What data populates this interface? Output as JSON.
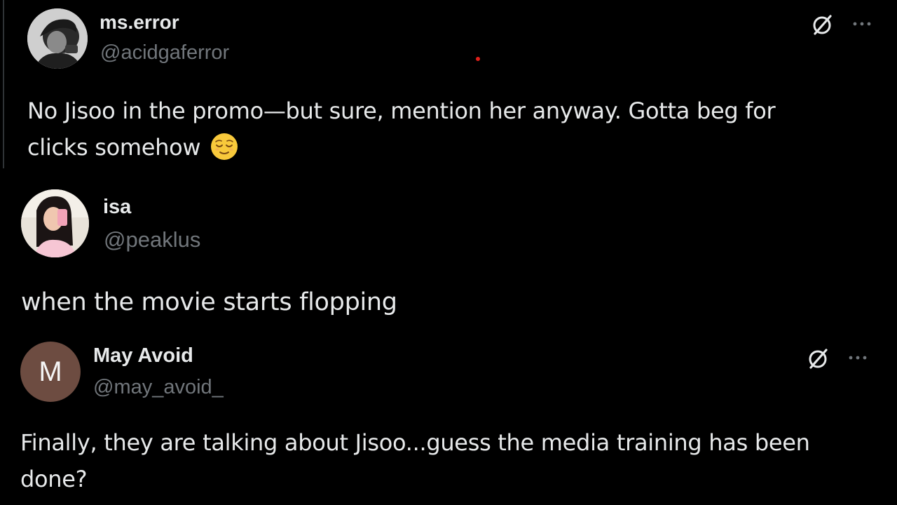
{
  "accent_colors": {
    "background": "#000000",
    "text_primary": "#e7e9ea",
    "text_secondary": "#71767b",
    "red_dot": "#e0201a",
    "avatar_m": "#6d4c41"
  },
  "tweets": [
    {
      "display_name": "ms.error",
      "handle": "@acidgaferror",
      "text": "No Jisoo  in the promo—but sure, mention her anyway. Gotta beg for clicks somehow",
      "emoji": "relieved-face-icon",
      "show_grok": true,
      "show_more": true
    },
    {
      "display_name": "isa",
      "handle": "@peaklus",
      "text": "when the movie starts flopping",
      "show_grok": false,
      "show_more": false
    },
    {
      "display_name": "May Avoid",
      "handle": "@may_avoid_",
      "avatar_letter": "M",
      "text": "Finally, they are talking about Jisoo...guess the media training has been done?",
      "show_grok": true,
      "show_more": true
    }
  ]
}
